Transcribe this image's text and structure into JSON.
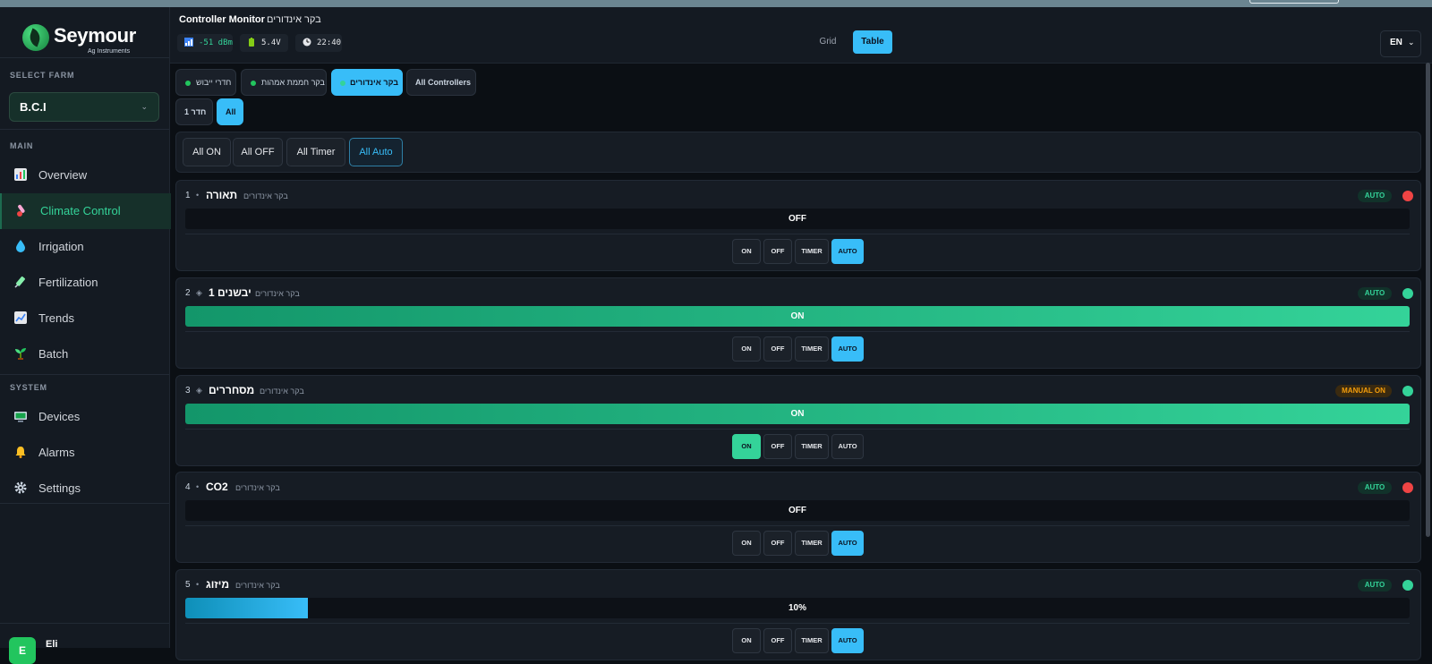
{
  "brand": {
    "name": "Seymour",
    "tagline": "Ag Instruments"
  },
  "sidebar": {
    "farm_label": "SELECT FARM",
    "farm_value": "B.C.I",
    "main_label": "MAIN",
    "system_label": "SYSTEM",
    "items": [
      {
        "label": "Overview",
        "icon": "overview-icon"
      },
      {
        "label": "Climate Control",
        "icon": "thermometer-icon"
      },
      {
        "label": "Irrigation",
        "icon": "droplet-icon"
      },
      {
        "label": "Fertilization",
        "icon": "syringe-icon"
      },
      {
        "label": "Trends",
        "icon": "trend-chart-icon"
      },
      {
        "label": "Batch",
        "icon": "seedling-icon"
      }
    ],
    "system_items": [
      {
        "label": "Devices",
        "icon": "monitor-icon"
      },
      {
        "label": "Alarms",
        "icon": "bell-icon"
      },
      {
        "label": "Settings",
        "icon": "gear-icon"
      }
    ],
    "user": {
      "initial": "E",
      "name": "Eli"
    }
  },
  "header": {
    "title": "Controller Monitor",
    "subtitle": "בקר אינדורים",
    "signal": "-51 dBm",
    "voltage": "5.4V",
    "time": "22:40",
    "view_grid": "Grid",
    "view_table": "Table",
    "lang": "EN"
  },
  "tabs": {
    "controllers": [
      "חדרי ייבוש",
      "בקר חממת אמהות",
      "בקר אינדורים",
      "All Controllers"
    ],
    "rooms": [
      "חדר 1",
      "All"
    ]
  },
  "bulk": [
    "All ON",
    "All OFF",
    "All Timer",
    "All Auto"
  ],
  "modes": [
    "ON",
    "OFF",
    "TIMER",
    "AUTO"
  ],
  "controllers": [
    {
      "num": "1",
      "name": "תאורה",
      "sub": "בקר אינדורים",
      "badge": "AUTO",
      "state": "OFF"
    },
    {
      "num": "2",
      "name": "יבשנים 1",
      "sub": "בקר אינדורים",
      "badge": "AUTO",
      "state": "ON"
    },
    {
      "num": "3",
      "name": "מסחררים",
      "sub": "בקר אינדורים",
      "badge": "MANUAL ON",
      "state": "ON"
    },
    {
      "num": "4",
      "name": "CO2",
      "sub": "בקר אינדורים",
      "badge": "AUTO",
      "state": "OFF"
    },
    {
      "num": "5",
      "name": "מיזוג",
      "sub": "בקר אינדורים",
      "badge": "AUTO",
      "state": "10%",
      "level": 0.1
    }
  ],
  "colors": {
    "accent": "#38bdf8",
    "on": "#34d399",
    "off_indicator": "#ef4444",
    "manual": "#f59e0b"
  }
}
